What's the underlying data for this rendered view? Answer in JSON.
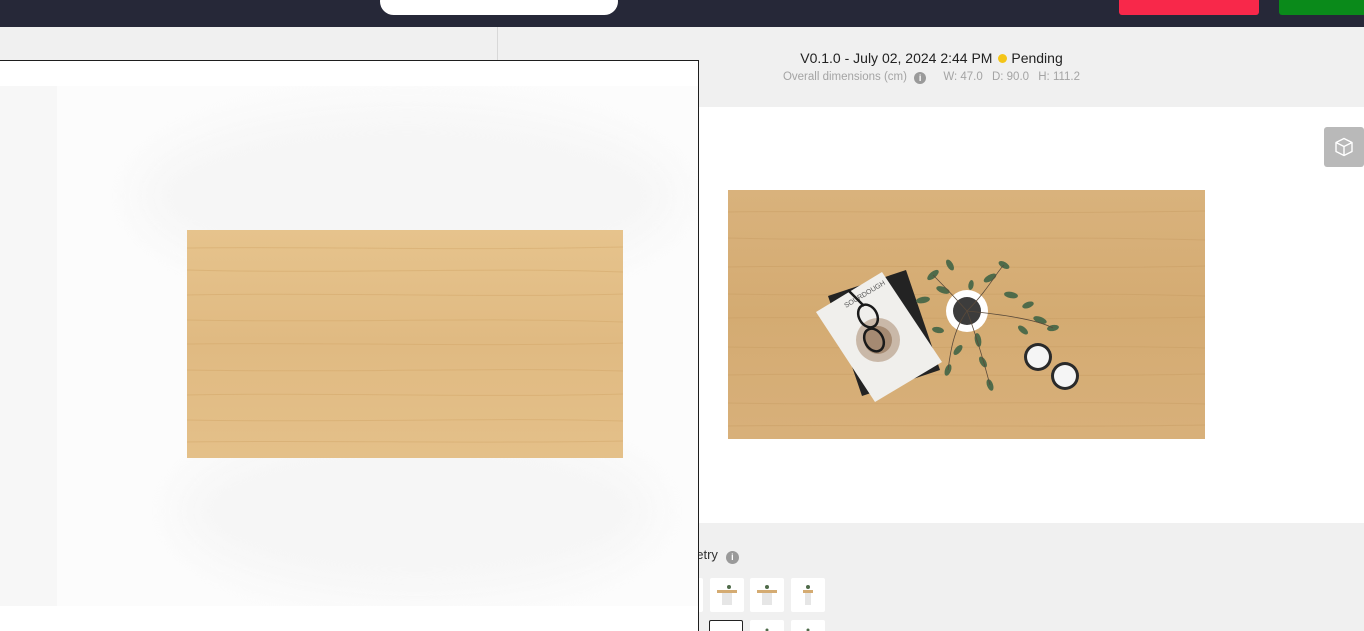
{
  "header": {},
  "preview": {
    "version": "V0.1.0 - July 02, 2024 2:44 PM",
    "status": "Pending",
    "status_color": "#f4c518",
    "dimensions_label": "Overall dimensions (cm)",
    "width": "W: 47.0",
    "depth": "D: 90.0",
    "height": "H: 111.2"
  },
  "viewer": {
    "view_toggle_icon": "cube-icon",
    "book_title": "SOURDOUGH"
  },
  "geometry": {
    "label": "netry",
    "info_icon": "info-icon",
    "selected_index": 4
  },
  "modal": {
    "content": "table top view"
  }
}
